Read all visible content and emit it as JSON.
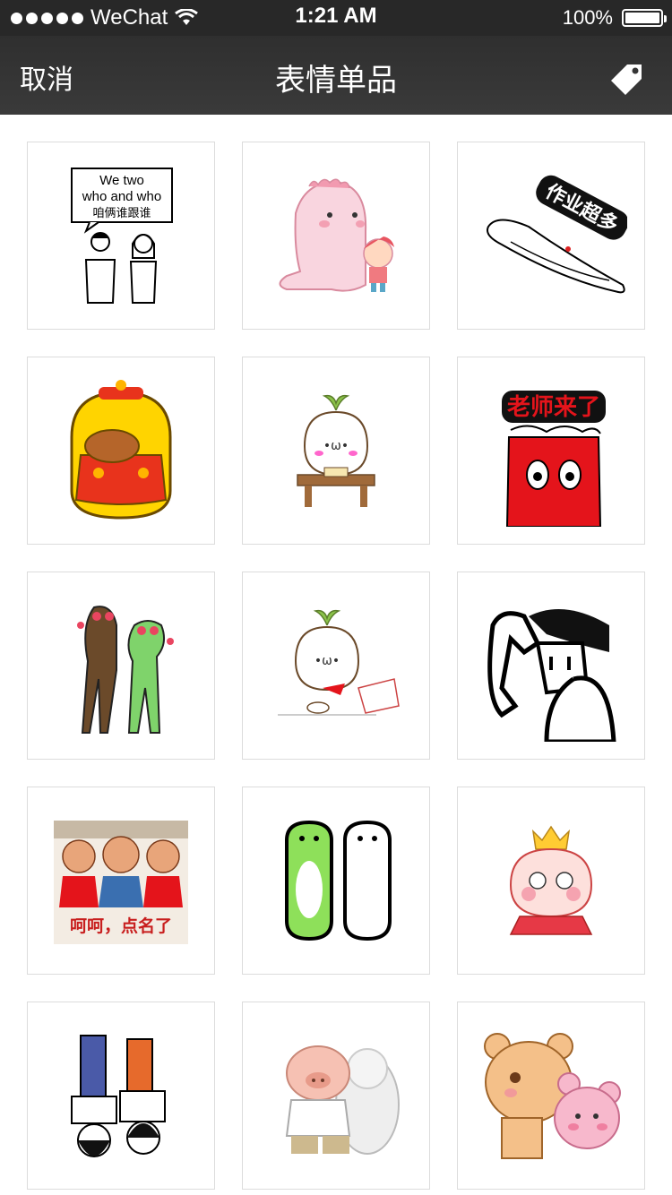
{
  "status_bar": {
    "carrier": "WeChat",
    "time": "1:21 AM",
    "battery": "100%",
    "battery_level": 1.0
  },
  "nav": {
    "cancel": "取消",
    "title": "表情单品",
    "right_icon": "tag-icon"
  },
  "stickers": [
    {
      "name": "we-two-who-and-who",
      "text": [
        "We two",
        "who and who",
        "咱俩谁跟谁"
      ]
    },
    {
      "name": "pink-dinosaur-girl",
      "text": []
    },
    {
      "name": "homework-too-much",
      "text": [
        "作业超多"
      ]
    },
    {
      "name": "yellow-chubby-eating-chicken",
      "text": []
    },
    {
      "name": "sprout-bun-at-desk",
      "text": []
    },
    {
      "name": "teacher-coming",
      "text": [
        "老师来了"
      ]
    },
    {
      "name": "horse-frog-love",
      "text": []
    },
    {
      "name": "sprout-bun-running",
      "text": []
    },
    {
      "name": "muscle-man",
      "text": []
    },
    {
      "name": "roll-call-kids",
      "text": [
        "呵呵，点名了"
      ]
    },
    {
      "name": "green-white-dogs",
      "text": []
    },
    {
      "name": "crown-kid-reading",
      "text": []
    },
    {
      "name": "upside-down-pair",
      "text": []
    },
    {
      "name": "pig-and-sheep",
      "text": []
    },
    {
      "name": "bear-hug",
      "text": []
    }
  ],
  "colors": {
    "status_bar": "#282828",
    "nav_bar": "#353535",
    "cell_border": "#dcdcdc"
  }
}
